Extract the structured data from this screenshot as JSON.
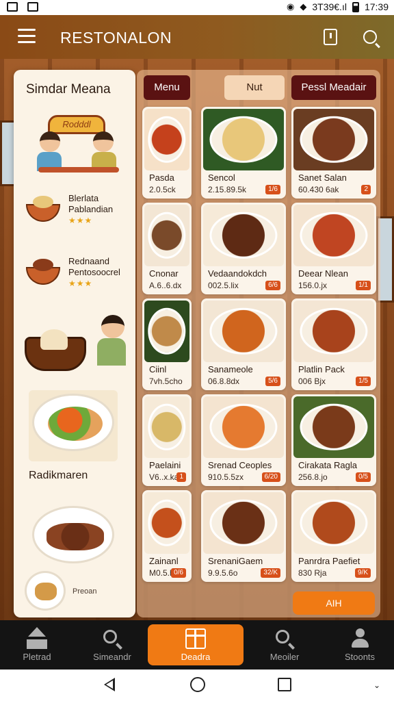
{
  "status_bar": {
    "info": "3T39€.ıl",
    "time": "17:39"
  },
  "app_bar": {
    "title": "RESTONALON"
  },
  "left_panel": {
    "title": "Simdar Meana",
    "sign_text": "Rodddl",
    "items": [
      {
        "label": "Blerlata Pablandian",
        "stars": "★★★"
      },
      {
        "label": "Rednaand Pentosoocrel",
        "stars": "★★★"
      }
    ],
    "featured_label": "Radikmaren",
    "small_label": "Preoan"
  },
  "tabs": [
    {
      "label": "Menu",
      "active": true
    },
    {
      "label": "Nut",
      "active": false
    },
    {
      "label": "Pessl Meadair",
      "active": true
    }
  ],
  "menu_items": [
    {
      "name": "Pasda",
      "price": "2.0.5ck",
      "badge": "",
      "colors": [
        "#f6e1c8",
        "#c5411c"
      ]
    },
    {
      "name": "Sencol",
      "price": "2.15.89.5k",
      "badge": "1/6",
      "colors": [
        "#2f5a24",
        "#e8c77a"
      ]
    },
    {
      "name": "Sanet Salan",
      "price": "60.430 6ak",
      "badge": "2",
      "colors": [
        "#6a3d22",
        "#7a3a1e"
      ]
    },
    {
      "name": "Cnonar",
      "price": "A.6..6.dx",
      "badge": "",
      "colors": [
        "#f3e6d4",
        "#7a4a2a"
      ]
    },
    {
      "name": "Vedaandokdch",
      "price": "002.5.lix",
      "badge": "6/6",
      "colors": [
        "#f6ead8",
        "#5e2a14"
      ]
    },
    {
      "name": "Deear Nlean",
      "price": "156.0.jx",
      "badge": "1/1",
      "colors": [
        "#f4e4d0",
        "#c04522"
      ]
    },
    {
      "name": "Ciinl",
      "price": "7vh.5cho",
      "badge": "",
      "colors": [
        "#2d4a1e",
        "#c08a4a"
      ]
    },
    {
      "name": "Sanameole",
      "price": "06.8.8dx",
      "badge": "5/6",
      "colors": [
        "#f3e6d4",
        "#d0651e"
      ]
    },
    {
      "name": "Platlin Pack",
      "price": "006 Bjx",
      "badge": "1/5",
      "colors": [
        "#f4e6d4",
        "#a8431c"
      ]
    },
    {
      "name": "Paelaini",
      "price": "V6..x.ka",
      "badge": "1",
      "colors": [
        "#f6ead8",
        "#d8b868"
      ]
    },
    {
      "name": "Srenad Ceoples",
      "price": "910.5.5zx",
      "badge": "6/20",
      "colors": [
        "#f4e4d0",
        "#e57a30"
      ]
    },
    {
      "name": "Cirakata Ragla",
      "price": "256.8.jo",
      "badge": "0/5",
      "colors": [
        "#4a6a2a",
        "#7a3a1a"
      ]
    },
    {
      "name": "Zainanl",
      "price": "M0.5.h",
      "badge": "0/6",
      "colors": [
        "#f6ead8",
        "#c4501c"
      ]
    },
    {
      "name": "SrenaniGaem",
      "price": "9.9.5.6o",
      "badge": "32/K",
      "colors": [
        "#f4e4d0",
        "#6a3016"
      ]
    },
    {
      "name": "Panrdra Paefiet",
      "price": "830 Rja",
      "badge": "9/K",
      "colors": [
        "#f6ead8",
        "#b04a1c"
      ]
    }
  ],
  "add_button": "AIH",
  "bottom_nav": [
    {
      "label": "Pletrad",
      "active": false
    },
    {
      "label": "Simeandr",
      "active": false
    },
    {
      "label": "Deadra",
      "active": true
    },
    {
      "label": "Meoiler",
      "active": false
    },
    {
      "label": "Stoonts",
      "active": false
    }
  ]
}
